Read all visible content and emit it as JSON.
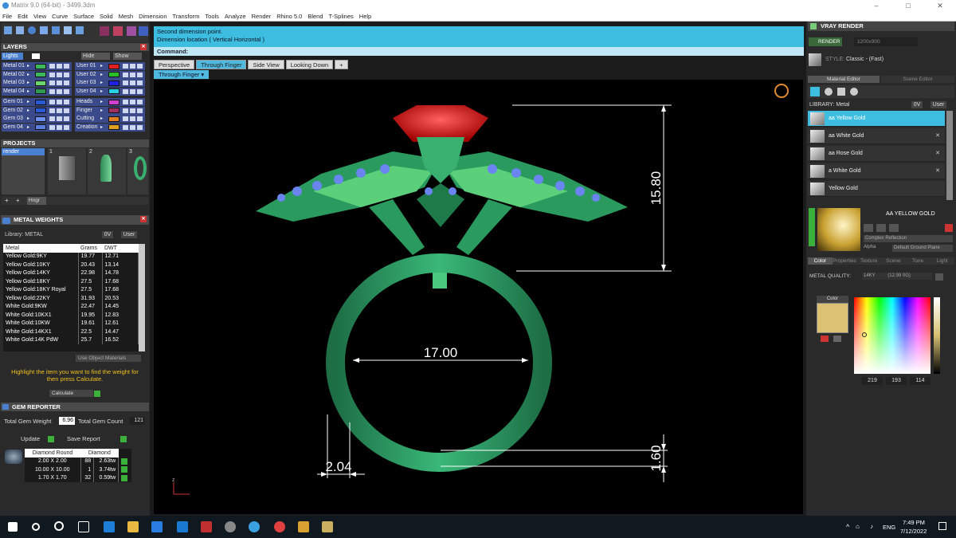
{
  "window": {
    "title": "Matrix 9.0 (64-bit) - 3499.3dm",
    "min": "–",
    "max": "□",
    "close": "✕"
  },
  "menu": [
    "File",
    "Edit",
    "View",
    "Curve",
    "Surface",
    "Solid",
    "Mesh",
    "Dimension",
    "Transform",
    "Tools",
    "Analyze",
    "Render",
    "Rhino 5.0",
    "Blend",
    "T-Splines",
    "Help"
  ],
  "layers": {
    "title": "LAYERS",
    "lights": "Lights",
    "hide": "Hide",
    "show": "Show",
    "left": [
      {
        "label": "Metal 01",
        "color": "#3cb85c"
      },
      {
        "label": "Metal 02",
        "color": "#3cb85c"
      },
      {
        "label": "Metal 03",
        "color": "#6bd66b"
      },
      {
        "label": "Metal 04",
        "color": "#2e9a52"
      },
      {
        "label": "Gem 01",
        "color": "#2a5bd7"
      },
      {
        "label": "Gem 02",
        "color": "#2a5bd7"
      },
      {
        "label": "Gem 03",
        "color": "#6d8ff0"
      },
      {
        "label": "Gem 04",
        "color": "#5a7fe0"
      }
    ],
    "right": [
      {
        "label": "User 01",
        "color": "#e02020"
      },
      {
        "label": "User 02",
        "color": "#2ac02a"
      },
      {
        "label": "User 03",
        "color": "#2020e0"
      },
      {
        "label": "User 04",
        "color": "#2ad0e0"
      },
      {
        "label": "Heads",
        "color": "#d040d0"
      },
      {
        "label": "Finger",
        "color": "#a03060"
      },
      {
        "label": "Cutting",
        "color": "#e08020"
      },
      {
        "label": "Creation",
        "color": "#e0a020"
      }
    ]
  },
  "projects": {
    "title": "PROJECTS",
    "item": "render",
    "hinge": "Hngr",
    "thumbs": [
      "1",
      "2",
      "3"
    ]
  },
  "metal_weights": {
    "title": "METAL WEIGHTS",
    "library": "Library: METAL",
    "filter": "0V",
    "user": "User",
    "headers": [
      "Metal",
      "Grams",
      "DWT"
    ],
    "rows": [
      [
        "Yellow Gold:9KY",
        "19.77",
        "12.71"
      ],
      [
        "Yellow Gold:10KY",
        "20.43",
        "13.14"
      ],
      [
        "Yellow Gold:14KY",
        "22.98",
        "14.78"
      ],
      [
        "Yellow Gold:18KY",
        "27.5",
        "17.68"
      ],
      [
        "Yellow Gold:18KY Royal",
        "27.5",
        "17.68"
      ],
      [
        "Yellow Gold:22KY",
        "31.93",
        "20.53"
      ],
      [
        "White Gold:9KW",
        "22.47",
        "14.45"
      ],
      [
        "White Gold:10KX1",
        "19.95",
        "12.83"
      ],
      [
        "White Gold:10KW",
        "19.61",
        "12.61"
      ],
      [
        "White Gold:14KX1",
        "22.5",
        "14.47"
      ],
      [
        "White Gold:14K PdW",
        "25.7",
        "16.52"
      ]
    ],
    "use_obj": "Use Object Materials",
    "hint": "Highlight the item you want to find the weight for then press Calculate.",
    "calculate": "Calculate"
  },
  "gem_reporter": {
    "title": "GEM REPORTER",
    "tgw_label": "Total Gem Weight",
    "tgw": "6.96",
    "tgc_label": "Total Gem Count",
    "tgc": "121",
    "update": "Update",
    "save": "Save Report",
    "headers": [
      "Diamond Round",
      "Diamond"
    ],
    "rows": [
      [
        "2.00 X 2.00",
        "88",
        "2.63tw"
      ],
      [
        "10.00 X 10.00",
        "1",
        "3.74tw"
      ],
      [
        "1.70 X 1.70",
        "32",
        "0.59tw"
      ]
    ]
  },
  "command": {
    "line1": "Second dimension point.",
    "line2": "Dimension location ( Vertical  Horizontal )",
    "label": "Command:"
  },
  "tabs": [
    "Perspective",
    "Through Finger",
    "Side View",
    "Looking Down",
    "+"
  ],
  "active_viewport": "Through Finger",
  "dimensions": {
    "height": "15.80",
    "inner": "17.00",
    "width": "2.04",
    "band": "1.60"
  },
  "axis": {
    "z": "z",
    "x": "x"
  },
  "vray": {
    "title": "VRAY RENDER",
    "render": "RENDER",
    "size": "1200x900",
    "style_label": "STYLE:",
    "style": "Classic - (Fast)",
    "tabs": [
      "Material Editor",
      "Scene Editor"
    ],
    "library": "LIBRARY: Metal",
    "filter": "0V",
    "user": "User",
    "materials": [
      "aa Yellow Gold",
      "aa White Gold",
      "aa Rose Gold",
      "a White Gold",
      "Yellow Gold"
    ],
    "selected": "AA YELLOW GOLD",
    "reflection": "Complex Reflection",
    "alpha": "Alpha",
    "ground": "Default Ground Plane",
    "subtabs": [
      "Color",
      "Properties",
      "Texture",
      "Scene",
      "Tone",
      "Light"
    ],
    "metal_quality_label": "METAL QUALITY:",
    "metal_quality": "14KY",
    "mq_value": "(12.99 0G)",
    "color_label": "Color",
    "rgb": [
      "219",
      "193",
      "114"
    ]
  },
  "taskbar": {
    "time": "7:49 PM",
    "date": "7/12/2022",
    "lang": "ENG"
  }
}
